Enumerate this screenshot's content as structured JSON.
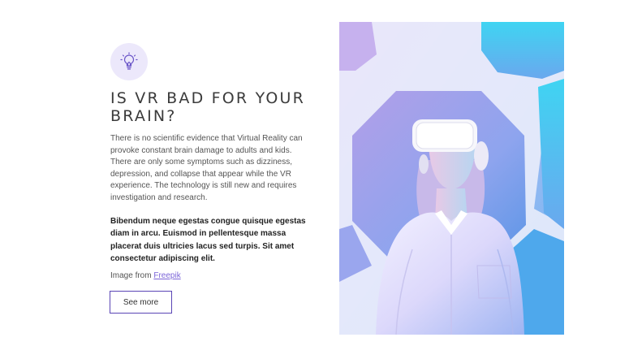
{
  "section": {
    "icon": "lightbulb-icon",
    "title": "IS VR BAD FOR YOUR BRAIN?",
    "body": "There is no scientific evidence that Virtual Reality can provoke constant brain damage to adults and kids. There are only some symptoms such as dizziness, depression, and collapse that appear while the VR experience. The technology is still new and requires investigation and research.",
    "bold": "Bibendum neque egestas congue quisque egestas diam in arcu. Euismod in pellentesque massa placerat duis ultricies lacus sed turpis. Sit amet consectetur adipiscing elit.",
    "credit_prefix": "Image from ",
    "credit_link": "Freepik",
    "button_label": "See more"
  },
  "colors": {
    "accent": "#5a45b5",
    "icon_bg": "#ece8fb",
    "link": "#7b64d8"
  }
}
